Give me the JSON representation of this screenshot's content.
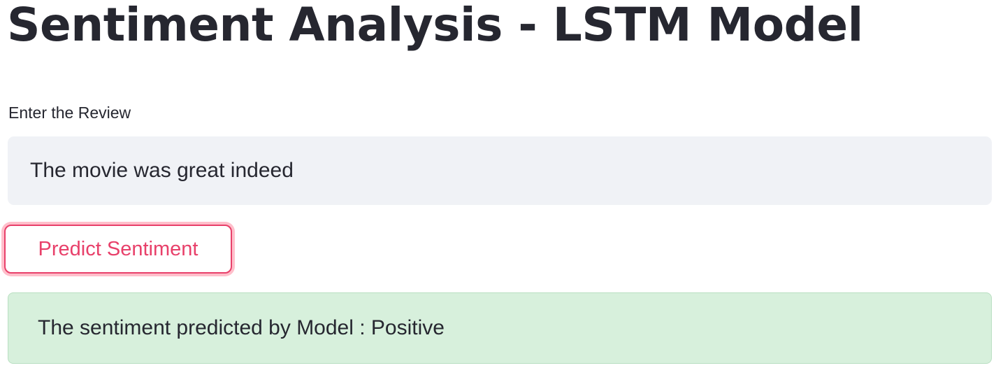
{
  "page": {
    "title": "Sentiment Analysis - LSTM Model"
  },
  "review_input": {
    "label": "Enter the Review",
    "value": "The movie was great indeed"
  },
  "predict_button": {
    "label": "Predict Sentiment",
    "accent_color": "#e8406a"
  },
  "result": {
    "text": "The sentiment predicted by Model : Positive",
    "background_color": "#d7f0dc"
  }
}
